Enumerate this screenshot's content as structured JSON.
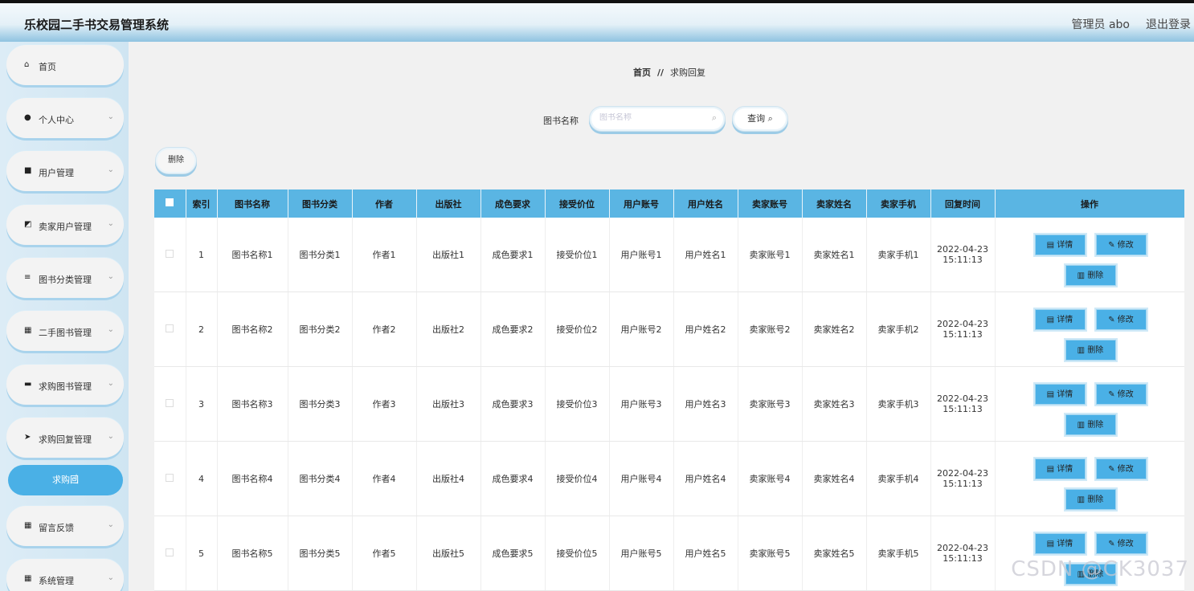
{
  "header": {
    "title": "乐校园二手书交易管理系统",
    "admin": "管理员 abo",
    "logout": "退出登录"
  },
  "sidebar": {
    "items": [
      {
        "label": "首页",
        "icon": "⌂"
      },
      {
        "label": "个人中心",
        "icon": "●"
      },
      {
        "label": "用户管理",
        "icon": "■"
      },
      {
        "label": "卖家用户管理",
        "icon": "◩"
      },
      {
        "label": "图书分类管理",
        "icon": "≡"
      },
      {
        "label": "二手图书管理",
        "icon": "▦"
      },
      {
        "label": "求购图书管理",
        "icon": "▬"
      },
      {
        "label": "求购回复管理",
        "icon": "➤"
      },
      {
        "label": "留言反馈",
        "icon": "▦"
      },
      {
        "label": "系统管理",
        "icon": "▦"
      }
    ],
    "active_sub": "求购回"
  },
  "breadcrumb": {
    "home": "首页",
    "sep": "//",
    "current": "求购回复"
  },
  "search": {
    "label": "图书名称",
    "placeholder": "图书名称",
    "query_btn": "查询"
  },
  "toolbar": {
    "delete_label": "删除"
  },
  "table": {
    "headers": [
      "索引",
      "图书名称",
      "图书分类",
      "作者",
      "出版社",
      "成色要求",
      "接受价位",
      "用户账号",
      "用户姓名",
      "卖家账号",
      "卖家姓名",
      "卖家手机",
      "回复时间",
      "操作"
    ],
    "rows": [
      {
        "idx": "1",
        "name": "图书名称1",
        "cat": "图书分类1",
        "author": "作者1",
        "pub": "出版社1",
        "cond": "成色要求1",
        "price": "接受价位1",
        "uacc": "用户账号1",
        "uname": "用户姓名1",
        "sacc": "卖家账号1",
        "sname": "卖家姓名1",
        "sphone": "卖家手机1",
        "date": "2022-04-23",
        "time": "15:11:13"
      },
      {
        "idx": "2",
        "name": "图书名称2",
        "cat": "图书分类2",
        "author": "作者2",
        "pub": "出版社2",
        "cond": "成色要求2",
        "price": "接受价位2",
        "uacc": "用户账号2",
        "uname": "用户姓名2",
        "sacc": "卖家账号2",
        "sname": "卖家姓名2",
        "sphone": "卖家手机2",
        "date": "2022-04-23",
        "time": "15:11:13"
      },
      {
        "idx": "3",
        "name": "图书名称3",
        "cat": "图书分类3",
        "author": "作者3",
        "pub": "出版社3",
        "cond": "成色要求3",
        "price": "接受价位3",
        "uacc": "用户账号3",
        "uname": "用户姓名3",
        "sacc": "卖家账号3",
        "sname": "卖家姓名3",
        "sphone": "卖家手机3",
        "date": "2022-04-23",
        "time": "15:11:13"
      },
      {
        "idx": "4",
        "name": "图书名称4",
        "cat": "图书分类4",
        "author": "作者4",
        "pub": "出版社4",
        "cond": "成色要求4",
        "price": "接受价位4",
        "uacc": "用户账号4",
        "uname": "用户姓名4",
        "sacc": "卖家账号4",
        "sname": "卖家姓名4",
        "sphone": "卖家手机4",
        "date": "2022-04-23",
        "time": "15:11:13"
      },
      {
        "idx": "5",
        "name": "图书名称5",
        "cat": "图书分类5",
        "author": "作者5",
        "pub": "出版社5",
        "cond": "成色要求5",
        "price": "接受价位5",
        "uacc": "用户账号5",
        "uname": "用户姓名5",
        "sacc": "卖家账号5",
        "sname": "卖家姓名5",
        "sphone": "卖家手机5",
        "date": "2022-04-23",
        "time": "15:11:13"
      }
    ],
    "actions": {
      "detail": "详情",
      "edit": "修改",
      "delete": "删除"
    }
  },
  "watermark": "CSDN @CK3037",
  "colors": {
    "accent": "#4ab0e6",
    "header_bg": "#5ab5e3",
    "sidebar_bg": "#dcecf6"
  }
}
